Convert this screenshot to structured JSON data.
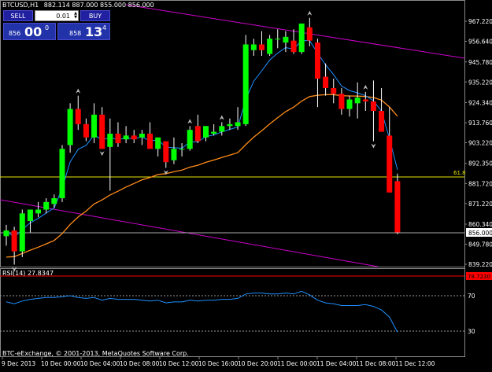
{
  "header": {
    "symbol_tf": "BTCUSD,H1",
    "ohlc": "882.114 887.000 855.000 856.000"
  },
  "one_click": {
    "sell_label": "SELL",
    "buy_label": "BUY",
    "lot": "0.01",
    "sell_small": "856",
    "sell_big": "00",
    "sell_sup": "0",
    "buy_small": "858",
    "buy_big": "13",
    "buy_sup": "4"
  },
  "fib_label": "61.8",
  "rsi_title": "RSI(14) 27.8347",
  "copyright": "BTC-eExchange, © 2001-2013, MetaQuotes Software Corp.",
  "colors": {
    "background": "#000000",
    "bull": "#00ff00",
    "bear": "#ff0000",
    "ma_fast": "#1e90ff",
    "ma_slow": "#ff8c1a",
    "trendline": "#cc00cc",
    "fib": "#e6e600",
    "price_line": "#aaaaaa",
    "rsi_line": "#1e90ff",
    "rsi_alert": "#ff0000"
  },
  "chart_data": [
    {
      "type": "candlestick",
      "ylabels": [
        "967.220",
        "956.640",
        "945.780",
        "935.220",
        "924.340",
        "913.760",
        "903.220",
        "892.350",
        "881.720",
        "871.220",
        "860.340",
        "849.780",
        "839.220"
      ],
      "ylim": [
        839.22,
        967.22
      ],
      "xlabels": [
        "9 Dec 2013",
        "10 Dec 00:00",
        "10 Dec 04:00",
        "10 Dec 08:00",
        "10 Dec 12:00",
        "10 Dec 16:00",
        "10 Dec 20:00",
        "11 Dec 00:00",
        "11 Dec 04:00",
        "11 Dec 08:00",
        "11 Dec 12:00"
      ],
      "current_price": "856.000",
      "fib_level": 879.5,
      "candles": [
        {
          "o": 854,
          "h": 860,
          "l": 849,
          "c": 857
        },
        {
          "o": 857,
          "h": 859,
          "l": 839,
          "c": 846
        },
        {
          "o": 846,
          "h": 868,
          "l": 843,
          "c": 866
        },
        {
          "o": 862,
          "h": 868,
          "l": 856,
          "c": 868
        },
        {
          "o": 866,
          "h": 872,
          "l": 864,
          "c": 868
        },
        {
          "o": 868,
          "h": 874,
          "l": 866,
          "c": 872
        },
        {
          "o": 871,
          "h": 876,
          "l": 869,
          "c": 874
        },
        {
          "o": 874,
          "h": 902,
          "l": 872,
          "c": 900
        },
        {
          "o": 902,
          "h": 924,
          "l": 898,
          "c": 921
        },
        {
          "o": 921,
          "h": 928,
          "l": 910,
          "c": 913
        },
        {
          "o": 913,
          "h": 916,
          "l": 904,
          "c": 906
        },
        {
          "o": 906,
          "h": 924,
          "l": 903,
          "c": 918
        },
        {
          "o": 918,
          "h": 922,
          "l": 900,
          "c": 900
        },
        {
          "o": 901,
          "h": 916,
          "l": 878,
          "c": 908
        },
        {
          "o": 908,
          "h": 914,
          "l": 901,
          "c": 903
        },
        {
          "o": 905,
          "h": 912,
          "l": 903,
          "c": 907
        },
        {
          "o": 907,
          "h": 910,
          "l": 903,
          "c": 905
        },
        {
          "o": 906,
          "h": 910,
          "l": 902,
          "c": 908
        },
        {
          "o": 908,
          "h": 914,
          "l": 903,
          "c": 900
        },
        {
          "o": 900,
          "h": 906,
          "l": 896,
          "c": 906
        },
        {
          "o": 904,
          "h": 904,
          "l": 890,
          "c": 893
        },
        {
          "o": 894,
          "h": 906,
          "l": 892,
          "c": 900
        },
        {
          "o": 900,
          "h": 903,
          "l": 896,
          "c": 900
        },
        {
          "o": 900,
          "h": 912,
          "l": 899,
          "c": 910
        },
        {
          "o": 912,
          "h": 918,
          "l": 903,
          "c": 904
        },
        {
          "o": 906,
          "h": 912,
          "l": 904,
          "c": 912
        },
        {
          "o": 908,
          "h": 913,
          "l": 907,
          "c": 909
        },
        {
          "o": 909,
          "h": 914,
          "l": 907,
          "c": 912
        },
        {
          "o": 912,
          "h": 916,
          "l": 910,
          "c": 913
        },
        {
          "o": 912,
          "h": 922,
          "l": 910,
          "c": 914
        },
        {
          "o": 913,
          "h": 960,
          "l": 912,
          "c": 955
        },
        {
          "o": 952,
          "h": 958,
          "l": 949,
          "c": 955
        },
        {
          "o": 955,
          "h": 962,
          "l": 949,
          "c": 952
        },
        {
          "o": 950,
          "h": 960,
          "l": 949,
          "c": 958
        },
        {
          "o": 958,
          "h": 963,
          "l": 953,
          "c": 958
        },
        {
          "o": 956,
          "h": 962,
          "l": 951,
          "c": 959
        },
        {
          "o": 957,
          "h": 963,
          "l": 950,
          "c": 951
        },
        {
          "o": 951,
          "h": 966,
          "l": 950,
          "c": 966
        },
        {
          "o": 964,
          "h": 969,
          "l": 954,
          "c": 957
        },
        {
          "o": 956,
          "h": 958,
          "l": 922,
          "c": 937
        },
        {
          "o": 938,
          "h": 945,
          "l": 928,
          "c": 932
        },
        {
          "o": 932,
          "h": 937,
          "l": 924,
          "c": 929
        },
        {
          "o": 929,
          "h": 932,
          "l": 918,
          "c": 921
        },
        {
          "o": 921,
          "h": 928,
          "l": 917,
          "c": 926
        },
        {
          "o": 924,
          "h": 935,
          "l": 916,
          "c": 927
        },
        {
          "o": 926,
          "h": 930,
          "l": 920,
          "c": 925
        },
        {
          "o": 925,
          "h": 936,
          "l": 904,
          "c": 920
        },
        {
          "o": 920,
          "h": 932,
          "l": 909,
          "c": 909
        },
        {
          "o": 907,
          "h": 922,
          "l": 879,
          "c": 877
        },
        {
          "o": 883,
          "h": 887,
          "l": 855,
          "c": 856
        }
      ]
    },
    {
      "type": "line",
      "name": "RSI(14)",
      "ylabels": [
        "70",
        "30"
      ],
      "ylim": [
        0,
        100
      ],
      "alert_label": "78.7230",
      "values": [
        62,
        60,
        63,
        65,
        66,
        67,
        67,
        68,
        69,
        67,
        66,
        67,
        64,
        66,
        65,
        65,
        65,
        64,
        63,
        64,
        61,
        62,
        62,
        64,
        63,
        64,
        64,
        65,
        65,
        66,
        71,
        72,
        72,
        71,
        71,
        72,
        71,
        74,
        70,
        64,
        61,
        60,
        58,
        58,
        58,
        59,
        57,
        53,
        45,
        28
      ]
    }
  ]
}
